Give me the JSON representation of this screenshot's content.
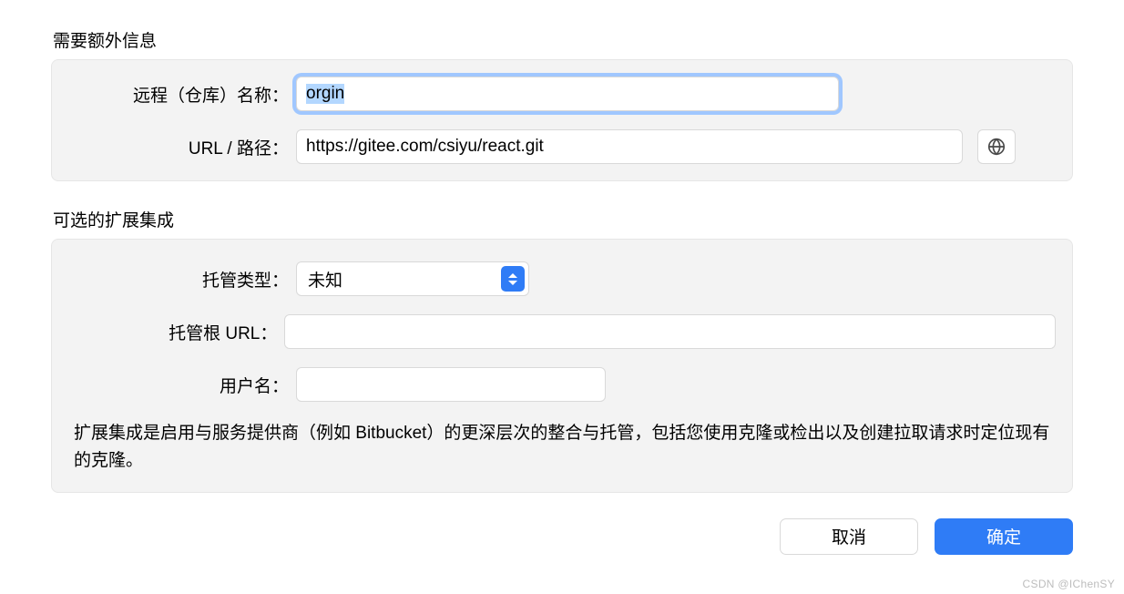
{
  "required": {
    "title": "需要额外信息",
    "remote_name_label": "远程（仓库）名称：",
    "remote_name_value": "orgin",
    "url_label": "URL / 路径：",
    "url_value": "https://gitee.com/csiyu/react.git"
  },
  "optional": {
    "title": "可选的扩展集成",
    "host_type_label": "托管类型：",
    "host_type_selected": "未知",
    "root_url_label": "托管根 URL：",
    "root_url_value": "",
    "username_label": "用户名：",
    "username_value": "",
    "hint": "扩展集成是启用与服务提供商（例如 Bitbucket）的更深层次的整合与托管，包括您使用克隆或检出以及创建拉取请求时定位现有的克隆。"
  },
  "footer": {
    "cancel_label": "取消",
    "ok_label": "确定"
  },
  "watermark": "CSDN @IChenSY"
}
